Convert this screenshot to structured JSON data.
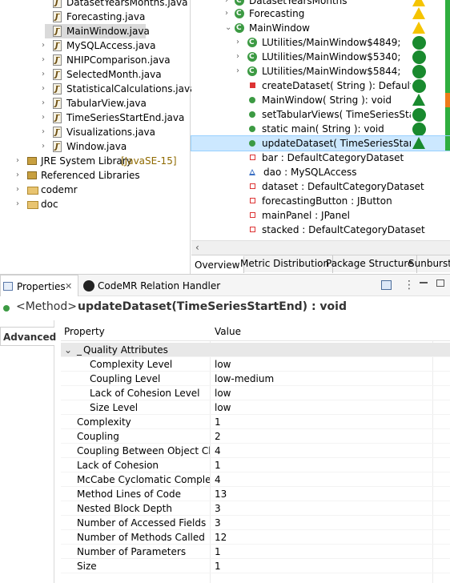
{
  "explorer": {
    "items": [
      {
        "label": "DatasetYearsMonths.java"
      },
      {
        "label": "Forecasting.java"
      },
      {
        "label": "MainWindow.java"
      },
      {
        "label": "MySQLAccess.java"
      },
      {
        "label": "NHIPComparison.java"
      },
      {
        "label": "SelectedMonth.java"
      },
      {
        "label": "StatisticalCalculations.java"
      },
      {
        "label": "TabularView.java"
      },
      {
        "label": "TimeSeriesStartEnd.java"
      },
      {
        "label": "Visualizations.java"
      },
      {
        "label": "Window.java"
      }
    ],
    "jre_label": "JRE System Library",
    "jre_version": "[JavaSE-15]",
    "referenced_label": "Referenced Libraries",
    "folders": [
      {
        "label": "codemr"
      },
      {
        "label": "doc"
      }
    ]
  },
  "outline": {
    "rows": [
      {
        "label": "DatasetYearsMonths"
      },
      {
        "label": "Forecasting"
      },
      {
        "label": "MainWindow"
      },
      {
        "label": "LUtilities/MainWindow$4849;"
      },
      {
        "label": "LUtilities/MainWindow$5340;"
      },
      {
        "label": "LUtilities/MainWindow$5844;"
      },
      {
        "label": "createDataset( String ): DefaultCategoryDataset"
      },
      {
        "label": "MainWindow( String ): void"
      },
      {
        "label": "setTabularViews( TimeSeriesStartEnd ): void"
      },
      {
        "label": "static main( String ): void"
      },
      {
        "label": "updateDataset( TimeSeriesStartEnd ): void"
      },
      {
        "label": "bar : DefaultCategoryDataset"
      },
      {
        "label": "dao : MySQLAccess"
      },
      {
        "label": "dataset : DefaultCategoryDataset"
      },
      {
        "label": "forecastingButton : JButton"
      },
      {
        "label": "mainPanel : JPanel"
      },
      {
        "label": "stacked : DefaultCategoryDataset"
      }
    ],
    "tabs": [
      {
        "label": "Overview"
      },
      {
        "label": "Metric Distribution"
      },
      {
        "label": "Package Structure"
      },
      {
        "label": "Sunburst"
      }
    ],
    "colors": {
      "good": "#198a2e",
      "warn": "#f5c400",
      "bar_green": "#2fae3f",
      "bar_orange": "#ee7a1a"
    }
  },
  "properties": {
    "tab_label": "Properties",
    "tab_close": "✕",
    "relation_tab_label": "CodeMR Relation Handler",
    "title_kind": "<Method>",
    "title_name": "updateDataset(TimeSeriesStartEnd) :  void",
    "advanced_label": "Advanced",
    "col_property": "Property",
    "col_value": "Value",
    "category": "Quality Attributes",
    "category_prefix": "_",
    "rows": [
      {
        "name": "Complexity Level",
        "value": "low",
        "indent": true
      },
      {
        "name": "Coupling Level",
        "value": "low-medium",
        "indent": true
      },
      {
        "name": "Lack of Cohesion Level",
        "value": "low",
        "indent": true
      },
      {
        "name": "Size Level",
        "value": "low",
        "indent": true
      },
      {
        "name": "Complexity",
        "value": "1"
      },
      {
        "name": "Coupling",
        "value": "2"
      },
      {
        "name": "Coupling Between Object Class",
        "value": "4"
      },
      {
        "name": "Lack of Cohesion",
        "value": "1"
      },
      {
        "name": "McCabe Cyclomatic Complexit",
        "value": "4"
      },
      {
        "name": "Method Lines of Code",
        "value": "13"
      },
      {
        "name": "Nested Block Depth",
        "value": "3"
      },
      {
        "name": "Number of Accessed Fields",
        "value": "3"
      },
      {
        "name": "Number of Methods Called",
        "value": "12"
      },
      {
        "name": "Number of Parameters",
        "value": "1"
      },
      {
        "name": "Size",
        "value": "1"
      }
    ]
  }
}
